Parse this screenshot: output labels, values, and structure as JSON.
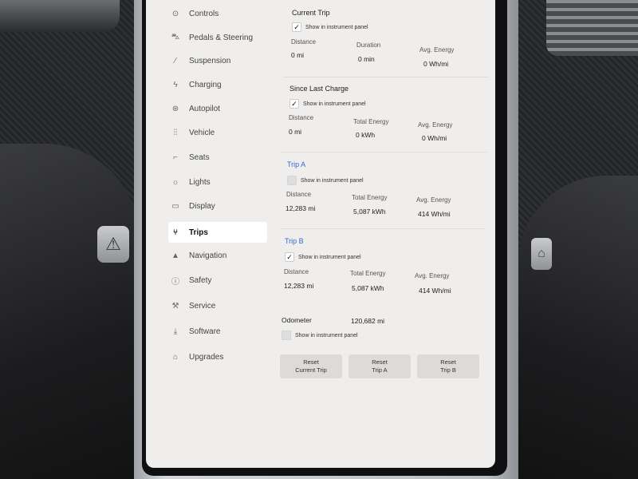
{
  "sidebar": {
    "items": [
      {
        "label": "Controls",
        "icon": "toggle-icon"
      },
      {
        "label": "Pedals & Steering",
        "icon": "car-icon"
      },
      {
        "label": "Suspension",
        "icon": "suspension-icon"
      },
      {
        "label": "Charging",
        "icon": "lightning-icon"
      },
      {
        "label": "Autopilot",
        "icon": "steering-wheel-icon"
      },
      {
        "label": "Vehicle",
        "icon": "sliders-icon"
      },
      {
        "label": "Seats",
        "icon": "seat-icon"
      },
      {
        "label": "Lights",
        "icon": "light-icon"
      },
      {
        "label": "Display",
        "icon": "display-icon"
      },
      {
        "label": "Trips",
        "icon": "trips-icon",
        "active": true
      },
      {
        "label": "Navigation",
        "icon": "navigation-arrow-icon"
      },
      {
        "label": "Safety",
        "icon": "safety-icon"
      },
      {
        "label": "Service",
        "icon": "wrench-icon"
      },
      {
        "label": "Software",
        "icon": "download-icon"
      },
      {
        "label": "Upgrades",
        "icon": "bag-icon"
      }
    ]
  },
  "current_trip": {
    "title": "Current Trip",
    "show_label": "Show in instrument panel",
    "show_checked": true,
    "labels": [
      "Distance",
      "Duration",
      "Avg. Energy"
    ],
    "values": [
      "0 mi",
      "0 min",
      "0 Wh/mi"
    ]
  },
  "since_last_charge": {
    "title": "Since Last Charge",
    "show_label": "Show in instrument panel",
    "show_checked": true,
    "labels": [
      "Distance",
      "Total Energy",
      "Avg. Energy"
    ],
    "values": [
      "0 mi",
      "0 kWh",
      "0 Wh/mi"
    ]
  },
  "trip_a": {
    "title": "Trip A",
    "show_label": "Show in instrument panel",
    "show_checked": false,
    "labels": [
      "Distance",
      "Total Energy",
      "Avg. Energy"
    ],
    "values": [
      "12,283 mi",
      "5,087 kWh",
      "414 Wh/mi"
    ]
  },
  "trip_b": {
    "title": "Trip B",
    "show_label": "Show in instrument panel",
    "show_checked": true,
    "labels": [
      "Distance",
      "Total Energy",
      "Avg. Energy"
    ],
    "values": [
      "12,283 mi",
      "5,087 kWh",
      "414 Wh/mi"
    ]
  },
  "odometer": {
    "label": "Odometer",
    "value": "120,682 mi",
    "show_label": "Show in instrument panel",
    "show_checked": false
  },
  "buttons": {
    "reset_current": [
      "Reset",
      "Current Trip"
    ],
    "reset_a": [
      "Reset",
      "Trip A"
    ],
    "reset_b": [
      "Reset",
      "Trip B"
    ]
  },
  "colors": {
    "screen_bg": "#efeeec",
    "accent_blue": "#2f6ad0",
    "active_item_bg": "#ffffff"
  }
}
